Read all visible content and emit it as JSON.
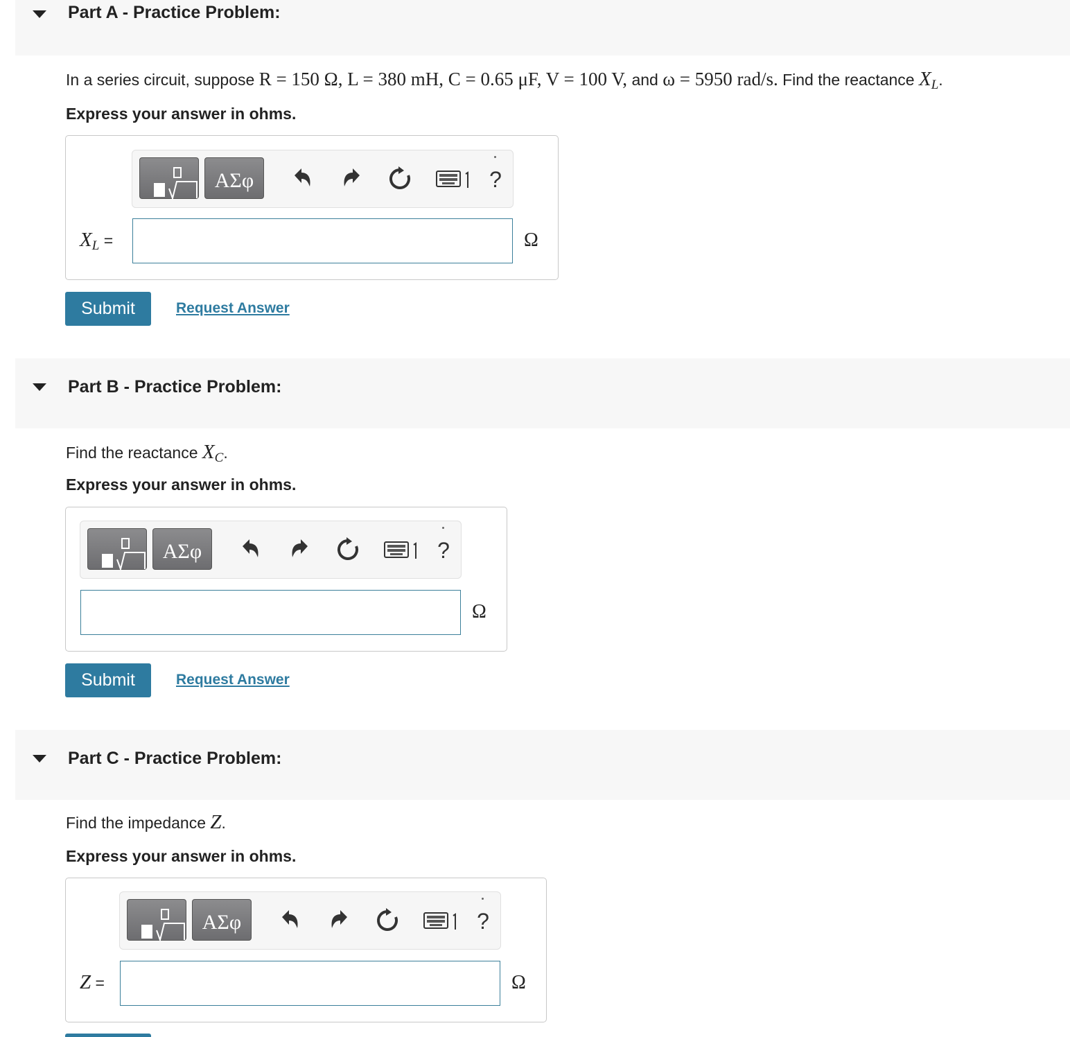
{
  "icons": {
    "caret": "caret-down-icon",
    "templates": "math-templates-icon",
    "undo": "undo-icon",
    "redo": "redo-icon",
    "reset": "reset-icon",
    "keyboard": "keyboard-icon",
    "help": "help-icon"
  },
  "colors": {
    "accent": "#2e7ba0",
    "header_bg": "#f7f7f7"
  },
  "toolbar": {
    "greek_label": "ΑΣφ",
    "help_label": "?"
  },
  "partA": {
    "title": "Part A - Practice Problem:",
    "problem": {
      "t1": "In a series circuit, suppose ",
      "eq1": "R = 150 Ω, L = 380 mH, C = 0.65 μF, V = 100 V,",
      "t2": " and ",
      "eq2": "ω = 5950 rad/s.",
      "t3": " Find the reactance ",
      "var": "X",
      "sub": "L",
      "end": "."
    },
    "express": "Express your answer in ohms.",
    "label_var": "X",
    "label_sub": "L",
    "label_eq": "=",
    "unit": "Ω",
    "submit": "Submit",
    "request": "Request Answer"
  },
  "partB": {
    "title": "Part B - Practice Problem:",
    "problem": {
      "t1": "Find the reactance ",
      "var": "X",
      "sub": "C",
      "end": "."
    },
    "express": "Express your answer in ohms.",
    "unit": "Ω",
    "submit": "Submit",
    "request": "Request Answer"
  },
  "partC": {
    "title": "Part C - Practice Problem:",
    "problem": {
      "t1": "Find the impedance ",
      "var": "Z",
      "end": "."
    },
    "express": "Express your answer in ohms.",
    "label_var": "Z",
    "label_eq": "=",
    "unit": "Ω"
  }
}
